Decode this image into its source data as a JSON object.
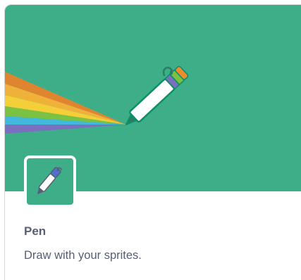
{
  "extension": {
    "title": "Pen",
    "description": "Draw with your sprites.",
    "banner_icon": "pen-rainbow-illustration",
    "thumbnail_icon": "pen-icon"
  },
  "colors": {
    "banner_bg": "#3dae87",
    "text": "#575e75",
    "card_border": "#d9d9d9",
    "pen_body": "#ffffff",
    "pen_outline": "#0b8e69",
    "rainbow": [
      "#e0852f",
      "#f0b13a",
      "#f5cf3a",
      "#7bc242",
      "#42b9dc",
      "#7b6fc0"
    ]
  }
}
